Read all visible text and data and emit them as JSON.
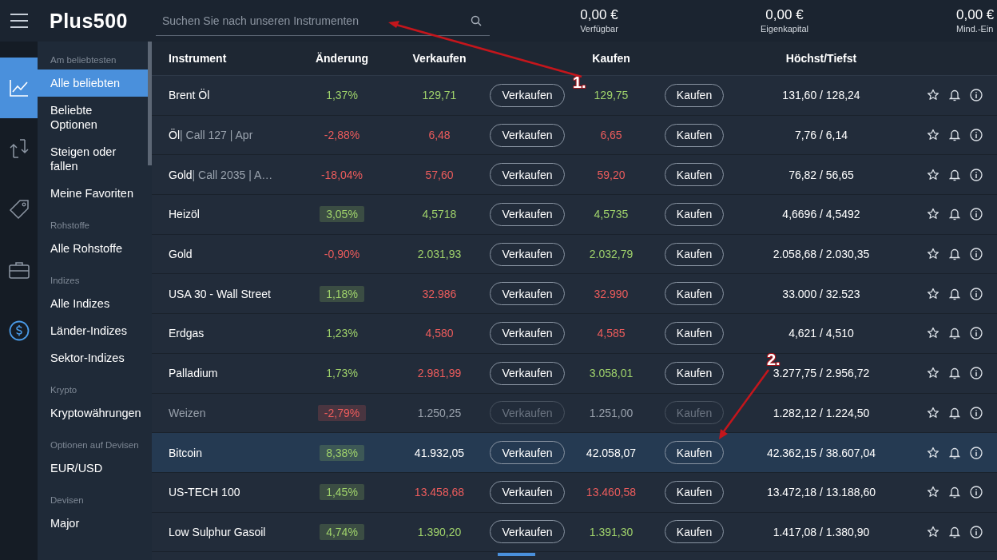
{
  "header": {
    "logo": "Plus500",
    "search": {
      "placeholder": "Suchen Sie nach unseren Instrumenten"
    },
    "stats": [
      {
        "value": "0,00 €",
        "label": "Verfügbar"
      },
      {
        "value": "0,00 €",
        "label": "Eigenkapital"
      },
      {
        "value": "0,00 €",
        "label": "Mind.-Ein"
      }
    ]
  },
  "rail": [
    {
      "kind": "chart",
      "selected": true
    },
    {
      "kind": "swap",
      "selected": false
    },
    {
      "kind": "tag",
      "selected": false
    },
    {
      "kind": "briefcase",
      "selected": false
    },
    {
      "kind": "dollar",
      "selected": false
    }
  ],
  "sidebar": [
    {
      "heading": "Am beliebtesten",
      "items": [
        {
          "label": "Alle beliebten",
          "selected": true
        },
        {
          "label": "Beliebte Optionen",
          "selected": false
        },
        {
          "label": "Steigen oder fallen",
          "selected": false
        },
        {
          "label": "Meine Favoriten",
          "selected": false
        }
      ]
    },
    {
      "heading": "Rohstoffe",
      "items": [
        {
          "label": "Alle Rohstoffe",
          "selected": false
        }
      ]
    },
    {
      "heading": "Indizes",
      "items": [
        {
          "label": "Alle Indizes",
          "selected": false
        },
        {
          "label": "Länder-Indizes",
          "selected": false
        },
        {
          "label": "Sektor-Indizes",
          "selected": false
        }
      ]
    },
    {
      "heading": "Krypto",
      "items": [
        {
          "label": "Kryptowährungen",
          "selected": false
        }
      ]
    },
    {
      "heading": "Optionen auf Devisen",
      "items": [
        {
          "label": "EUR/USD",
          "selected": false
        }
      ]
    },
    {
      "heading": "Devisen",
      "items": [
        {
          "label": "Major",
          "selected": false
        }
      ]
    }
  ],
  "table": {
    "columns": [
      "Instrument",
      "Änderung",
      "Verkaufen",
      "Kaufen",
      "Höchst/Tiefst"
    ],
    "rows": [
      {
        "name": "Brent Öl",
        "change": {
          "value": "1,37%",
          "color": "#9fd26b",
          "highlight": false
        },
        "sell": {
          "value": "129,71",
          "color": "#9fd26b"
        },
        "sell_button": "Verkaufen",
        "buy": {
          "value": "129,75",
          "color": "#9fd26b"
        },
        "buy_button": "Kaufen",
        "high_low": "131,60 / 128,24",
        "disabled": false,
        "selected": false
      },
      {
        "name": "Öl",
        "detail": "| Call 127 | Apr",
        "change": {
          "value": "-2,88%",
          "color": "#ec5c5c",
          "highlight": false
        },
        "sell": {
          "value": "6,48",
          "color": "#ec5c5c"
        },
        "sell_button": "Verkaufen",
        "buy": {
          "value": "6,65",
          "color": "#ec5c5c"
        },
        "buy_button": "Kaufen",
        "high_low": "7,76 / 6,14",
        "disabled": false,
        "selected": false
      },
      {
        "name": "Gold",
        "detail": "| Call 2035 | A…",
        "change": {
          "value": "-18,04%",
          "color": "#ec5c5c",
          "highlight": false
        },
        "sell": {
          "value": "57,60",
          "color": "#ec5c5c"
        },
        "sell_button": "Verkaufen",
        "buy": {
          "value": "59,20",
          "color": "#ec5c5c"
        },
        "buy_button": "Kaufen",
        "high_low": "76,82 / 56,65",
        "disabled": false,
        "selected": false
      },
      {
        "name": "Heizöl",
        "change": {
          "value": "3,05%",
          "color": "#9fd26b",
          "highlight": true
        },
        "sell": {
          "value": "4,5718",
          "color": "#9fd26b"
        },
        "sell_button": "Verkaufen",
        "buy": {
          "value": "4,5735",
          "color": "#9fd26b"
        },
        "buy_button": "Kaufen",
        "high_low": "4,6696 / 4,5492",
        "disabled": false,
        "selected": false
      },
      {
        "name": "Gold",
        "change": {
          "value": "-0,90%",
          "color": "#ec5c5c",
          "highlight": false
        },
        "sell": {
          "value": "2.031,93",
          "color": "#9fd26b"
        },
        "sell_button": "Verkaufen",
        "buy": {
          "value": "2.032,79",
          "color": "#9fd26b"
        },
        "buy_button": "Kaufen",
        "high_low": "2.058,68 / 2.030,35",
        "disabled": false,
        "selected": false
      },
      {
        "name": "USA 30 - Wall Street",
        "change": {
          "value": "1,18%",
          "color": "#9fd26b",
          "highlight": true
        },
        "sell": {
          "value": "32.986",
          "color": "#ec5c5c"
        },
        "sell_button": "Verkaufen",
        "buy": {
          "value": "32.990",
          "color": "#ec5c5c"
        },
        "buy_button": "Kaufen",
        "high_low": "33.000 / 32.523",
        "disabled": false,
        "selected": false
      },
      {
        "name": "Erdgas",
        "change": {
          "value": "1,23%",
          "color": "#9fd26b",
          "highlight": false
        },
        "sell": {
          "value": "4,580",
          "color": "#ec5c5c"
        },
        "sell_button": "Verkaufen",
        "buy": {
          "value": "4,585",
          "color": "#ec5c5c"
        },
        "buy_button": "Kaufen",
        "high_low": "4,621 / 4,510",
        "disabled": false,
        "selected": false
      },
      {
        "name": "Palladium",
        "change": {
          "value": "1,73%",
          "color": "#9fd26b",
          "highlight": false
        },
        "sell": {
          "value": "2.981,99",
          "color": "#ec5c5c"
        },
        "sell_button": "Verkaufen",
        "buy": {
          "value": "3.058,01",
          "color": "#9fd26b"
        },
        "buy_button": "Kaufen",
        "high_low": "3.277,75 / 2.956,72",
        "disabled": false,
        "selected": false
      },
      {
        "name": "Weizen",
        "change": {
          "value": "-2,79%",
          "color": "#ec5c5c",
          "highlight": true
        },
        "sell": {
          "value": "1.250,25",
          "color": "#98a0ab"
        },
        "sell_button": "Verkaufen",
        "buy": {
          "value": "1.251,00",
          "color": "#98a0ab"
        },
        "buy_button": "Kaufen",
        "high_low": "1.282,12 / 1.224,50",
        "disabled": true,
        "selected": false
      },
      {
        "name": "Bitcoin",
        "change": {
          "value": "8,38%",
          "color": "#9fd26b",
          "highlight": true
        },
        "sell": {
          "value": "41.932,05",
          "color": "#ffffff"
        },
        "sell_button": "Verkaufen",
        "buy": {
          "value": "42.058,07",
          "color": "#ffffff"
        },
        "buy_button": "Kaufen",
        "high_low": "42.362,15 / 38.607,04",
        "disabled": false,
        "selected": true
      },
      {
        "name": "US-TECH 100",
        "change": {
          "value": "1,45%",
          "color": "#9fd26b",
          "highlight": true
        },
        "sell": {
          "value": "13.458,68",
          "color": "#ec5c5c"
        },
        "sell_button": "Verkaufen",
        "buy": {
          "value": "13.460,58",
          "color": "#ec5c5c"
        },
        "buy_button": "Kaufen",
        "high_low": "13.472,18 / 13.188,60",
        "disabled": false,
        "selected": false
      },
      {
        "name": "Low Sulphur Gasoil",
        "change": {
          "value": "4,74%",
          "color": "#9fd26b",
          "highlight": true
        },
        "sell": {
          "value": "1.390,20",
          "color": "#9fd26b"
        },
        "sell_button": "Verkaufen",
        "buy": {
          "value": "1.391,30",
          "color": "#9fd26b"
        },
        "buy_button": "Kaufen",
        "high_low": "1.417,08 / 1.380,90",
        "disabled": false,
        "selected": false
      }
    ]
  },
  "annotations": [
    {
      "label": "1."
    },
    {
      "label": "2."
    }
  ]
}
